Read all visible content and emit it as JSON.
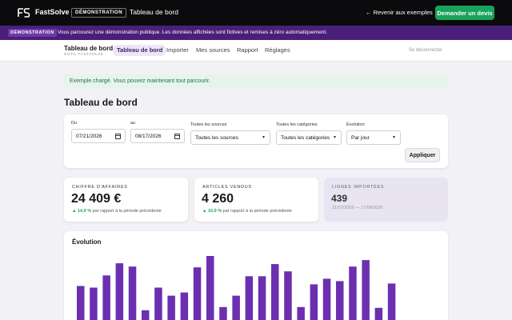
{
  "topbar": {
    "brand": "FastSolve",
    "demo_badge": "DÉMONSTRATION",
    "title": "Tableau de bord",
    "back_link": "← Revenir aux exemples",
    "cta": "Demander un devis"
  },
  "banner": {
    "badge": "DÉMONSTRATION",
    "text": "Vous parcourez une démonstration publique. Les données affichées sont fictives et remises à zéro automatiquement."
  },
  "nav": {
    "title": "Tableau de bord",
    "subtitle": "OUTIL FASTSOLVE",
    "tabs": [
      "Tableau de bord",
      "Importer",
      "Mes sources",
      "Rapport",
      "Réglages"
    ],
    "active_tab": "Tableau de bord",
    "logout": "Se déconnecter"
  },
  "alert": "Exemple chargé. Vous pouvez maintenant tout parcourir.",
  "page_title": "Tableau de bord",
  "filters": {
    "from_label": "Du",
    "from_value": "07/21/2026",
    "to_label": "au",
    "to_value": "08/17/2026",
    "source_label": "Toutes les sources",
    "source_value": "Toutes les sources",
    "category_label": "Toutes les catégories",
    "category_value": "Toutes les catégories",
    "evolution_label": "Évolution",
    "evolution_value": "Par jour",
    "apply": "Appliquer"
  },
  "kpis": {
    "revenue": {
      "label": "CHIFFRE D'AFFAIRES",
      "value": "24 409 €",
      "delta": "▲ 14,9 %",
      "delta_text": "par rapport à la période précédente"
    },
    "items": {
      "label": "ARTICLES VENDUS",
      "value": "4 260",
      "delta": "▲ 10,9 %",
      "delta_text": "par rapport à la période précédente"
    },
    "rows": {
      "label": "LIGNES IMPORTÉES",
      "value": "439",
      "range": "21/07/2026 — 17/08/2026"
    }
  },
  "chart": {
    "title": "Évolution",
    "bar_color": "#6b2fb0"
  },
  "chart_data": {
    "type": "bar",
    "title": "Évolution",
    "values": [
      42,
      40,
      55,
      70,
      66,
      12,
      40,
      30,
      34,
      65,
      79,
      16,
      30,
      54,
      54,
      69,
      60,
      16,
      44,
      51,
      48,
      66,
      74,
      15,
      45
    ]
  }
}
